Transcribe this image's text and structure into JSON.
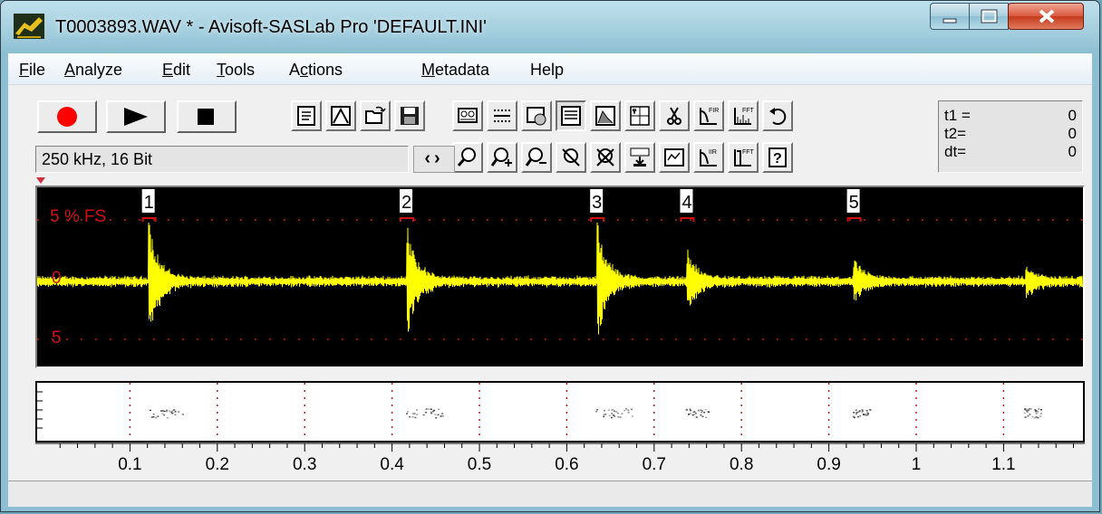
{
  "window": {
    "title": "T0003893.WAV * - Avisoft-SASLab Pro  'DEFAULT.INI'"
  },
  "menu": [
    {
      "label": "File",
      "acc": "F",
      "rest": "ile"
    },
    {
      "label": "Analyze",
      "acc": "A",
      "rest": "nalyze"
    },
    {
      "label": "Edit",
      "acc": "E",
      "rest": "dit"
    },
    {
      "label": "Tools",
      "acc": "T",
      "rest": "ools"
    },
    {
      "label": "Actions",
      "pre": "A",
      "acc": "c",
      "rest": "tions"
    },
    {
      "label": "Metadata",
      "acc": "M",
      "rest": "etadata"
    },
    {
      "label": "Help",
      "pre": "",
      "acc": "",
      "rest": "Help"
    }
  ],
  "format_display": "250 kHz, 16 Bit",
  "nav_arrows": "‹›",
  "cursor_readout": {
    "t1_label": "t1 =",
    "t1_value": "0",
    "t2_label": "t2=",
    "t2_value": "0",
    "dt_label": "dt=",
    "dt_value": "0"
  },
  "oscillogram": {
    "top_label": "5 % FS",
    "mid_label": "0",
    "bottom_label": "5",
    "trace_color": "#ffff00",
    "label_color": "#d01010",
    "markers": [
      {
        "label": "1",
        "time": 0.121
      },
      {
        "label": "2",
        "time": 0.416
      },
      {
        "label": "3",
        "time": 0.634
      },
      {
        "label": "4",
        "time": 0.737
      },
      {
        "label": "5",
        "time": 0.928
      }
    ]
  },
  "spectrogram": {
    "gridline_times": [
      0.1,
      0.2,
      0.3,
      0.4,
      0.5,
      0.6,
      0.7,
      0.8,
      0.9,
      1.0,
      1.1
    ]
  },
  "time_axis": {
    "ticks": [
      "0.1",
      "0.2",
      "0.3",
      "0.4",
      "0.5",
      "0.6",
      "0.7",
      "0.8",
      "0.9",
      "1",
      "1.1"
    ],
    "tick_values": [
      0.1,
      0.2,
      0.3,
      0.4,
      0.5,
      0.6,
      0.7,
      0.8,
      0.9,
      1.0,
      1.1
    ]
  },
  "pulses": [
    {
      "time": 0.121,
      "amplitude": 1.0
    },
    {
      "time": 0.416,
      "amplitude": 1.0
    },
    {
      "time": 0.634,
      "amplitude": 1.0
    },
    {
      "time": 0.737,
      "amplitude": 0.5
    },
    {
      "time": 0.928,
      "amplitude": 0.32
    },
    {
      "time": 1.125,
      "amplitude": 0.22
    }
  ],
  "status_text": ""
}
